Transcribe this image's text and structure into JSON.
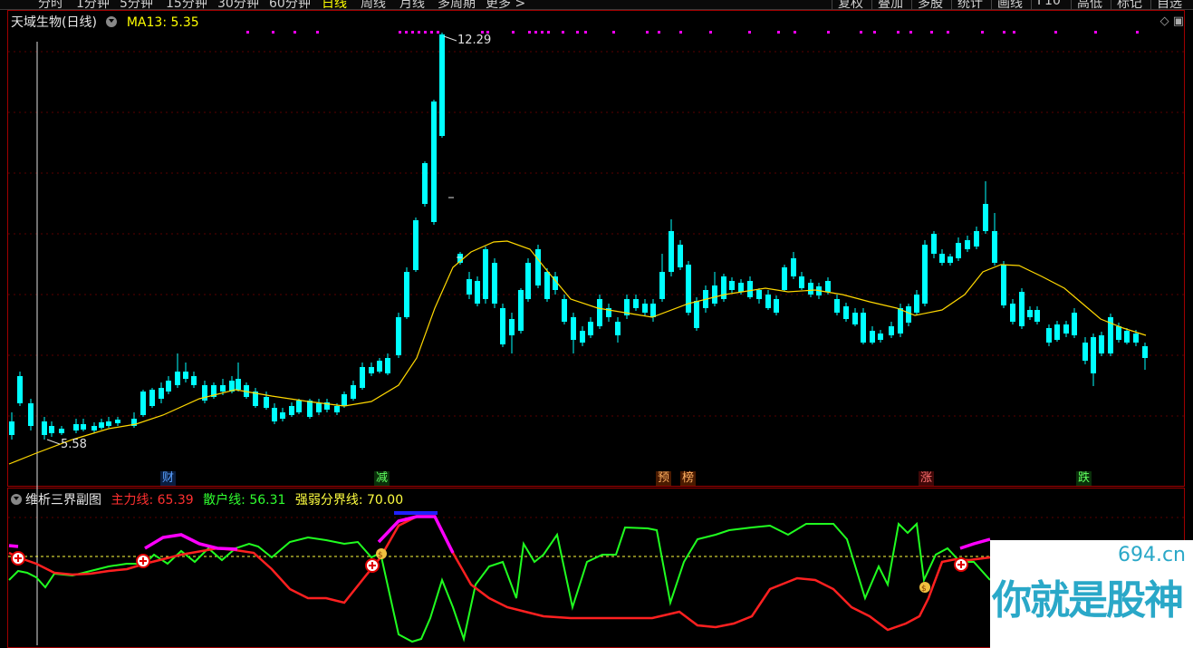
{
  "toolbar": {
    "period_tabs": [
      "分时",
      "1分钟",
      "5分钟",
      "15分钟",
      "30分钟",
      "60分钟",
      "日线",
      "周线",
      "月线",
      "多周期",
      "更多 >"
    ],
    "active_tab": "日线",
    "right_buttons": [
      "复权",
      "叠加",
      "多股",
      "统计",
      "画线",
      "F10",
      "标记",
      "自选"
    ]
  },
  "main_chart": {
    "stock_name": "天域生物(日线)",
    "ma_label": "MA13: 5.35",
    "high_label": "12.29",
    "low_label": "5.58",
    "events": [
      "财",
      "减",
      "预",
      "榜",
      "涨",
      "跌"
    ],
    "colors": {
      "up": "#ff3030",
      "down": "#00ffff",
      "ma": "#ffd800",
      "marker": "#ff00ff"
    }
  },
  "sub_chart": {
    "title": "维析三界副图",
    "main_line": "主力线: 65.39",
    "retail_line": "散户线: 56.31",
    "threshold_line": "强弱分界线: 70.00",
    "colors": {
      "main": "#ff2020",
      "retail": "#20ff20",
      "strong": "#ff00ff",
      "threshold": "#ffff40"
    }
  },
  "watermark": {
    "url": "694.cn",
    "slogan": "你就是股神"
  }
}
